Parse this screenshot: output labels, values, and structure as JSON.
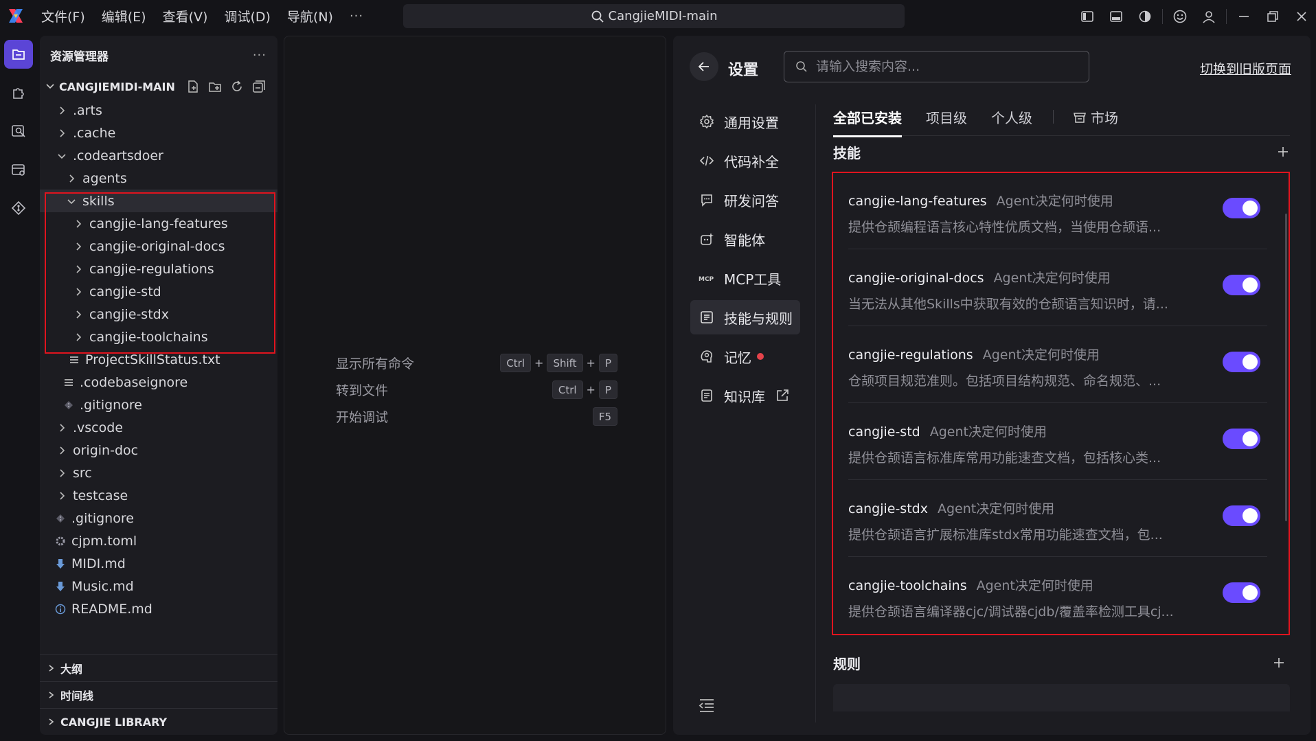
{
  "window": {
    "menu": [
      "文件(F)",
      "编辑(E)",
      "查看(V)",
      "调试(D)",
      "导航(N)"
    ],
    "menu_more": "···",
    "search_title": "CangjieMIDI-main"
  },
  "explorer": {
    "title": "资源管理器",
    "more": "···",
    "project": "CANGJIEMIDI-MAIN",
    "tree": [
      {
        "label": ".arts",
        "type": "folder",
        "depth": 1,
        "expanded": false
      },
      {
        "label": ".cache",
        "type": "folder",
        "depth": 1,
        "expanded": false
      },
      {
        "label": ".codeartsdoer",
        "type": "folder",
        "depth": 1,
        "expanded": true
      },
      {
        "label": "agents",
        "type": "folder",
        "depth": 2,
        "expanded": false
      },
      {
        "label": "skills",
        "type": "folder",
        "depth": 2,
        "expanded": true,
        "selected": true
      },
      {
        "label": "cangjie-lang-features",
        "type": "folder",
        "depth": 3,
        "expanded": false
      },
      {
        "label": "cangjie-original-docs",
        "type": "folder",
        "depth": 3,
        "expanded": false
      },
      {
        "label": "cangjie-regulations",
        "type": "folder",
        "depth": 3,
        "expanded": false
      },
      {
        "label": "cangjie-std",
        "type": "folder",
        "depth": 3,
        "expanded": false
      },
      {
        "label": "cangjie-stdx",
        "type": "folder",
        "depth": 3,
        "expanded": false
      },
      {
        "label": "cangjie-toolchains",
        "type": "folder",
        "depth": 3,
        "expanded": false
      },
      {
        "label": "ProjectSkillStatus.txt",
        "type": "text-file",
        "depth": 3
      },
      {
        "label": ".codebaseignore",
        "type": "text-file",
        "depth": 2
      },
      {
        "label": ".gitignore",
        "type": "git-file",
        "depth": 2
      },
      {
        "label": ".vscode",
        "type": "folder",
        "depth": 1,
        "expanded": false
      },
      {
        "label": "origin-doc",
        "type": "folder",
        "depth": 1,
        "expanded": false
      },
      {
        "label": "src",
        "type": "folder",
        "depth": 1,
        "expanded": false
      },
      {
        "label": "testcase",
        "type": "folder",
        "depth": 1,
        "expanded": false
      },
      {
        "label": ".gitignore",
        "type": "git-file",
        "depth": 1
      },
      {
        "label": "cjpm.toml",
        "type": "gear-file",
        "depth": 1
      },
      {
        "label": "MIDI.md",
        "type": "markdown-file",
        "depth": 1
      },
      {
        "label": "Music.md",
        "type": "markdown-file",
        "depth": 1
      },
      {
        "label": "README.md",
        "type": "info-file",
        "depth": 1
      }
    ],
    "sections": [
      "大纲",
      "时间线",
      "CANGJIE LIBRARY"
    ]
  },
  "editor": {
    "commands": [
      {
        "label": "显示所有命令",
        "keys": [
          "Ctrl",
          "Shift",
          "P"
        ]
      },
      {
        "label": "转到文件",
        "keys": [
          "Ctrl",
          "P"
        ]
      },
      {
        "label": "开始调试",
        "keys": [
          "F5"
        ]
      }
    ]
  },
  "settings": {
    "title": "设置",
    "search_placeholder": "请输入搜索内容...",
    "switch_old": "切换到旧版页面",
    "nav": [
      {
        "label": "通用设置",
        "icon": "gear-icon"
      },
      {
        "label": "代码补全",
        "icon": "code-icon"
      },
      {
        "label": "研发问答",
        "icon": "chat-icon"
      },
      {
        "label": "智能体",
        "icon": "agent-icon"
      },
      {
        "label": "MCP工具",
        "icon": "mcp-icon"
      },
      {
        "label": "技能与规则",
        "icon": "rules-icon",
        "active": true
      },
      {
        "label": "记忆",
        "icon": "memory-icon",
        "dot": true
      },
      {
        "label": "知识库",
        "icon": "knowledge-icon",
        "external": true
      }
    ],
    "tabs": [
      {
        "label": "全部已安装",
        "active": true
      },
      {
        "label": "项目级"
      },
      {
        "label": "个人级"
      },
      {
        "label": "市场",
        "icon": "store-icon"
      }
    ],
    "skills_title": "技能",
    "rules_title": "规则",
    "skills": [
      {
        "name": "cangjie-lang-features",
        "mode": "Agent决定何时使用",
        "desc": "提供仓颉编程语言核心特性优质文档，当使用仓颉语...",
        "enabled": true
      },
      {
        "name": "cangjie-original-docs",
        "mode": "Agent决定何时使用",
        "desc": "当无法从其他Skills中获取有效的仓颉语言知识时，请...",
        "enabled": true
      },
      {
        "name": "cangjie-regulations",
        "mode": "Agent决定何时使用",
        "desc": "仓颉项目规范准则。包括项目结构规范、命名规范、...",
        "enabled": true
      },
      {
        "name": "cangjie-std",
        "mode": "Agent决定何时使用",
        "desc": "提供仓颉语言标准库常用功能速查文档，包括核心类...",
        "enabled": true
      },
      {
        "name": "cangjie-stdx",
        "mode": "Agent决定何时使用",
        "desc": "提供仓颉语言扩展标准库stdx常用功能速查文档，包...",
        "enabled": true
      },
      {
        "name": "cangjie-toolchains",
        "mode": "Agent决定何时使用",
        "desc": "提供仓颉语言编译器cjc/调试器cjdb/覆盖率检测工具cj...",
        "enabled": true
      }
    ],
    "colors": {
      "accent": "#6a4bff",
      "highlight": "#e0141e",
      "active_activity": "#5b45d6"
    }
  }
}
